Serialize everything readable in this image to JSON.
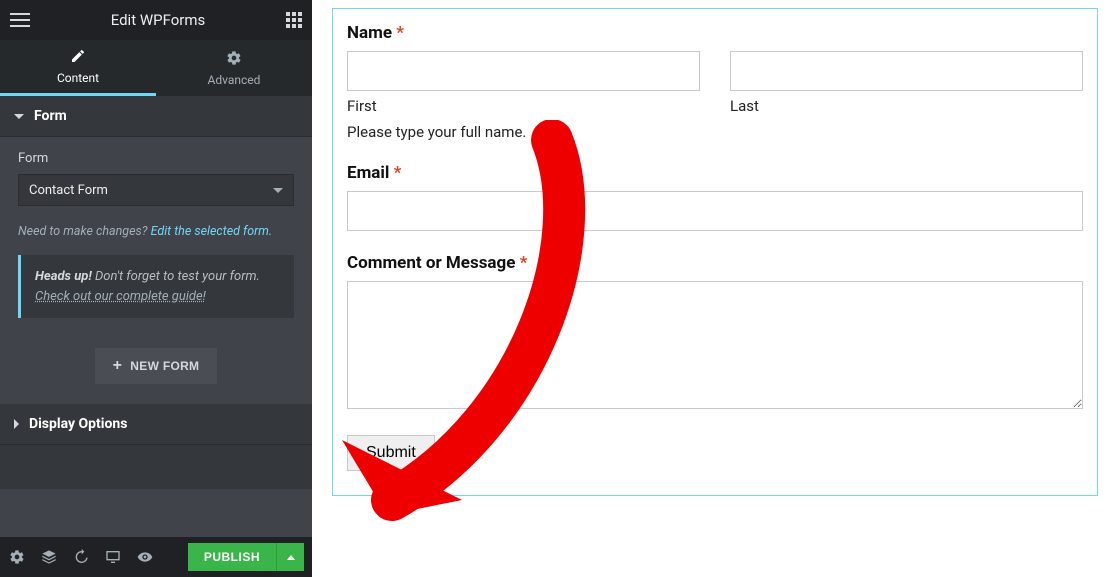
{
  "header": {
    "title": "Edit WPForms"
  },
  "tabs": {
    "content": "Content",
    "advanced": "Advanced"
  },
  "sections": {
    "form": {
      "title": "Form",
      "field_label": "Form",
      "select_value": "Contact Form",
      "hint_prefix": "Need to make changes? ",
      "hint_link": "Edit the selected form.",
      "callout_strong": "Heads up!",
      "callout_rest": " Don't forget to test your form. ",
      "callout_link": "Check out our complete guide!",
      "new_form_btn": "NEW FORM"
    },
    "display": {
      "title": "Display Options"
    }
  },
  "footer": {
    "publish": "PUBLISH"
  },
  "preview": {
    "name": {
      "label": "Name",
      "first": "First",
      "last": "Last",
      "desc": "Please type your full name."
    },
    "email": {
      "label": "Email"
    },
    "comment": {
      "label": "Comment or Message"
    },
    "submit": "Submit"
  }
}
